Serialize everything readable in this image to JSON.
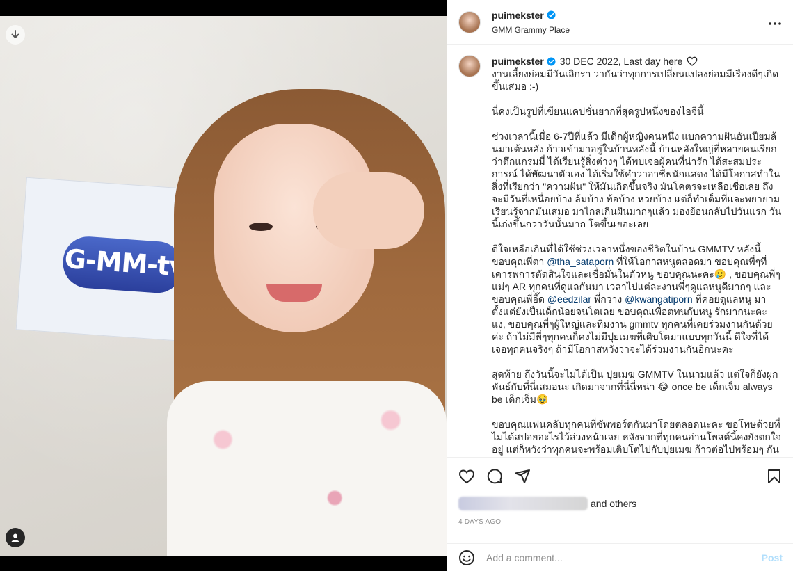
{
  "post": {
    "username": "puimekster",
    "location": "GMM Grammy Place",
    "photo_logo": "G-MM-tv"
  },
  "caption": {
    "username": "puimekster",
    "date": "30 DEC 2022, Last day here",
    "paragraphs": [
      "งานเลี้ยงย่อมมีวันเลิกรา ว่ากันว่าทุกการเปลี่ยนแปลงย่อมมีเรื่องดีๆเกิดขึ้นเสมอ :-)",
      "นี่คงเป็นรูปที่เขียนแคปชั่นยากที่สุดรูปหนึ่งของไอจีนี้",
      "ช่วงเวลานี้เมื่อ 6-7ปีที่แล้ว มีเด็กผู้หญิงคนหนึ่ง แบกความฝันอันเปียมล้นมาเต้นหลัง ก้าวเข้ามาอยู่ในบ้านหลังนี้ บ้านหลังใหญ่ที่หลายคนเรียกว่าตึกแกรมมี่ ได้เรียนรู้สิ่งต่างๆ ได้พบเจอผู้คนที่น่ารัก ได้สะสมประการณ์ ได้พัฒนาตัวเอง ได้เริ่มใช้คำว่าอาชีพนักแสดง ได้มีโอกาสทำในสิ่งที่เรียกว่า \"ความฝัน\" ให้มันเกิดขึ้นจริง มันโคตรจะเหลือเชื่อเลย ถึงจะมีวันที่เหนื่อยบ้าง ล้มบ้าง ท้อบ้าง หวยบ้าง แต่ก็ทำเต็มที่และพยายามเรียนรู้จากมันเสมอ มาไกลเกินฝันมากๆแล้ว มองย้อนกลับไปวันแรก วันนี้เก่งขึ้นกว่าวันนั้นมาก โตขึ้นเยอะเลย",
      "ดีใจเหลือเกินที่ได้ใช้ช่วงเวลาหนึ่งของชีวิตในบ้าน GMMTV หลังนี้ ขอบคุณพี่ตา",
      "ที่ให้โอกาสหนูตลอดมา ขอบคุณพี่ๆที่เคารพการตัดสินใจและเชื่อมั่นในตัวหนู ขอบคุณนะคะ🥲 , ขอบคุณพี่ๆ แม่ๆ AR ทุกคนที่ดูแลกันมา เวลาไปแต่ละงานพี่ๆดูแลหนูดีมากๆ และขอบคุณพี่อี๊ด",
      "พี่กวาง",
      "ที่คอยดูแลหนู มาตั้งแต่ยังเป็นเด็กน้อยจนโตเลย ขอบคุณเพื่อตทนกับหนู รักมากนะคะ แง, ขอบคุณพี่ๆผู้ใหญ่และทีมงาน gmmtv ทุกคนที่เคยร่วมงานกันด้วยค่ะ ถ้าไม่มีพี่ๆทุกคนก็คงไม่มีปุยเมฆที่เติบโตมาแบบทุกวันนี้ ดีใจที่ได้เจอทุกคนจริงๆ ถ้ามีโอกาสหวังว่าจะได้ร่วมงานกันอีกนะคะ",
      "สุดท้าย ถึงวันนี้จะไม่ได้เป็น ปุยเมฆ GMMTV ในนามแล้ว แต่ใจก็ยังผูกพันธ์กับที่นี่เสมอนะ เกิดมาจากที่นี่นี่หน่า 😂 once be เด็กเจ็ม always be เด็กเจ็ม🥹",
      "ขอบคุณแฟนคลับทุกคนที่ซัพพอร์ตกันมาโดยตลอดนะคะ ขอโทษด้วยที่ไม่ได้สปอยอะไรไว้ล่วงหน้าเลย หลังจากที่ทุกคนอ่านโพสต์นี้คงยังตกใจอยู่ แต่ก็หวังว่าทุกคนจะพร้อมเติบโตไปกับปุยเมฆ ก้าวต่อไปพร้อมๆ กัน"
    ],
    "mentions": {
      "sataporn": "@tha_sataporn",
      "eedzilar": "@eedzilar",
      "kwangatiporn": "@kwangatiporn"
    }
  },
  "likes": {
    "suffix": "and others"
  },
  "timestamp": "4 DAYS AGO",
  "comment_box": {
    "placeholder": "Add a comment...",
    "post_label": "Post"
  },
  "icons": {
    "download": "download-icon",
    "user": "user-icon",
    "more": "more-icon",
    "verified": "verified-badge-icon",
    "heart": "heart-icon",
    "comment": "comment-icon",
    "share": "share-icon",
    "save": "bookmark-icon",
    "emoji": "emoji-icon"
  },
  "colors": {
    "mention": "#00376b",
    "verified": "#0095f6",
    "post_disabled": "#b2dffc"
  }
}
